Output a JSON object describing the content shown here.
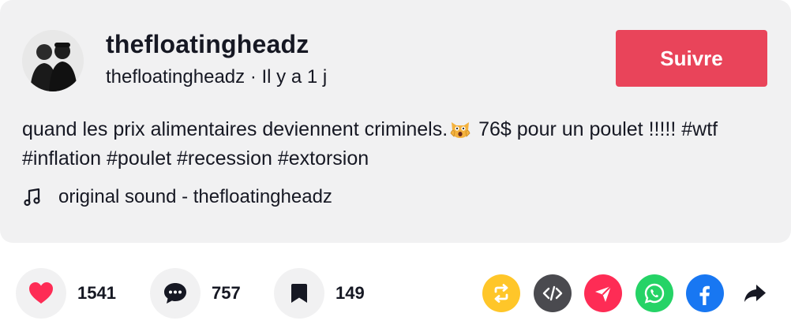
{
  "author": {
    "display_name": "thefloatingheadz",
    "handle": "thefloatingheadz",
    "separator": " · ",
    "time_ago": "Il y a 1 j"
  },
  "follow_button": {
    "label": "Suivre",
    "color": "#e9445a"
  },
  "description": {
    "text_before_emoji": "quand les prix alimentaires deviennent criminels.",
    "emoji": "screaming-cat-emoji",
    "text_after_emoji": " 76$ pour un poulet !!!!! #wtf #inflation #poulet #recession #extorsion"
  },
  "sound": {
    "icon": "music-note-icon",
    "label": "original sound - thefloatingheadz"
  },
  "actions": {
    "likes": {
      "icon": "heart-icon",
      "count": "1541",
      "color": "#fe2c55"
    },
    "comments": {
      "icon": "comment-icon",
      "count": "757"
    },
    "bookmarks": {
      "icon": "bookmark-icon",
      "count": "149"
    }
  },
  "share": [
    {
      "icon": "repost-icon",
      "color": "#ffc629"
    },
    {
      "icon": "embed-code-icon",
      "color": "#4a4a4f"
    },
    {
      "icon": "send-icon",
      "color": "#fe2c55"
    },
    {
      "icon": "whatsapp-icon",
      "color": "#25d366"
    },
    {
      "icon": "facebook-icon",
      "color": "#1877f2"
    },
    {
      "icon": "share-arrow-icon",
      "color": "#161823"
    }
  ]
}
